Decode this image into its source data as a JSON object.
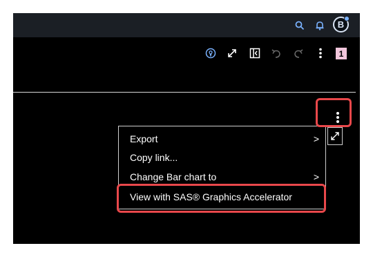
{
  "topbar": {
    "icons": [
      "search-icon",
      "bell-icon"
    ],
    "avatar_initial": "B"
  },
  "toolbar": {
    "icons": [
      "lightbulb-icon",
      "expand-icon",
      "panel-toggle-icon",
      "undo-icon",
      "redo-icon",
      "more-options-icon"
    ],
    "page_badge": "1"
  },
  "object": {
    "icons": [
      "more-options-icon",
      "maximize-icon"
    ]
  },
  "context_menu": {
    "items": [
      {
        "label": "Export",
        "submenu": ">"
      },
      {
        "label": "Copy link...",
        "submenu": ""
      },
      {
        "label": "Change Bar chart to",
        "submenu": ">"
      },
      {
        "label": "View with SAS® Graphics Accelerator",
        "submenu": ""
      }
    ]
  },
  "colors": {
    "app_background": "#000000",
    "topbar_background": "#1b1f25",
    "accent_blue": "#7ab2ff",
    "highlight_red": "#e9484b",
    "page_badge": "#f2c6dc"
  }
}
